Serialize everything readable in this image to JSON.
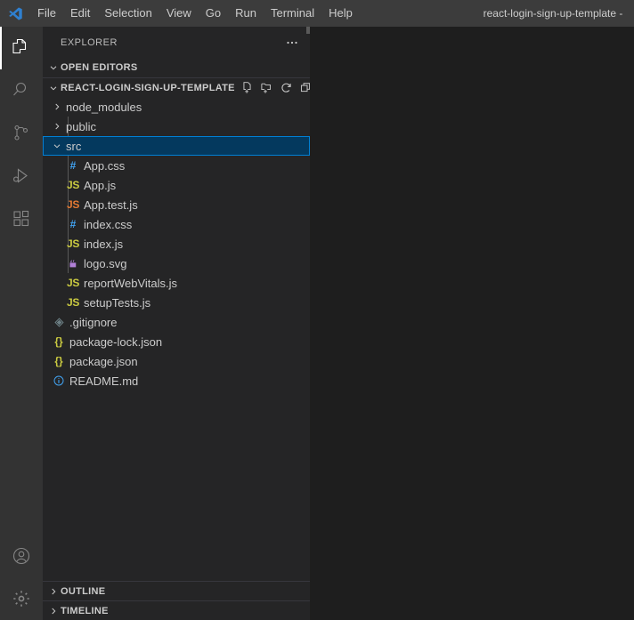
{
  "titlebar": {
    "logo_icon": "vscode-logo-icon",
    "window_title": "react-login-sign-up-template -",
    "menus": [
      {
        "label": "File"
      },
      {
        "label": "Edit"
      },
      {
        "label": "Selection"
      },
      {
        "label": "View"
      },
      {
        "label": "Go"
      },
      {
        "label": "Run"
      },
      {
        "label": "Terminal"
      },
      {
        "label": "Help"
      }
    ]
  },
  "activitybar": {
    "top_items": [
      {
        "name": "explorer",
        "icon": "files-icon",
        "title": "Explorer",
        "active": true
      },
      {
        "name": "search",
        "icon": "search-icon",
        "title": "Search",
        "active": false
      },
      {
        "name": "source-control",
        "icon": "source-control-icon",
        "title": "Source Control",
        "active": false
      },
      {
        "name": "run-debug",
        "icon": "run-and-debug-icon",
        "title": "Run and Debug",
        "active": false
      },
      {
        "name": "extensions",
        "icon": "extensions-icon",
        "title": "Extensions",
        "active": false
      }
    ],
    "bottom_items": [
      {
        "name": "accounts",
        "icon": "account-icon",
        "title": "Accounts"
      },
      {
        "name": "settings",
        "icon": "gear-icon",
        "title": "Manage"
      }
    ]
  },
  "sidebar": {
    "title": "EXPLORER",
    "more_actions_icon": "ellipsis-icon",
    "open_editors": {
      "label": "OPEN EDITORS",
      "expanded": true,
      "twisty_icon": "chevron-down-icon"
    },
    "workspace": {
      "label": "REACT-LOGIN-SIGN-UP-TEMPLATE",
      "expanded": true,
      "twisty_icon": "chevron-down-icon",
      "actions": [
        {
          "name": "new-file",
          "icon": "new-file-icon",
          "title": "New File"
        },
        {
          "name": "new-folder",
          "icon": "new-folder-icon",
          "title": "New Folder"
        },
        {
          "name": "refresh",
          "icon": "refresh-icon",
          "title": "Refresh Explorer"
        },
        {
          "name": "collapse-all",
          "icon": "collapse-all-icon",
          "title": "Collapse Folders in Explorer"
        }
      ]
    },
    "tree": [
      {
        "label": "node_modules",
        "type": "folder",
        "expanded": false,
        "depth": 0,
        "icon": "chevron-right-icon",
        "selected": false
      },
      {
        "label": "public",
        "type": "folder",
        "expanded": false,
        "depth": 0,
        "icon": "chevron-right-icon",
        "selected": false
      },
      {
        "label": "src",
        "type": "folder",
        "expanded": true,
        "depth": 0,
        "icon": "chevron-down-icon",
        "selected": true
      },
      {
        "label": "App.css",
        "type": "css",
        "depth": 1,
        "icon": "css-file-icon",
        "glyph": "#",
        "selected": false
      },
      {
        "label": "App.js",
        "type": "js",
        "depth": 1,
        "icon": "js-file-icon",
        "glyph": "JS",
        "selected": false
      },
      {
        "label": "App.test.js",
        "type": "jstest",
        "depth": 1,
        "icon": "js-test-file-icon",
        "glyph": "JS",
        "selected": false
      },
      {
        "label": "index.css",
        "type": "css",
        "depth": 1,
        "icon": "css-file-icon",
        "glyph": "#",
        "selected": false
      },
      {
        "label": "index.js",
        "type": "js",
        "depth": 1,
        "icon": "js-file-icon",
        "glyph": "JS",
        "selected": false
      },
      {
        "label": "logo.svg",
        "type": "svg",
        "depth": 1,
        "icon": "svg-file-icon",
        "selected": false
      },
      {
        "label": "reportWebVitals.js",
        "type": "js",
        "depth": 1,
        "icon": "js-file-icon",
        "glyph": "JS",
        "selected": false
      },
      {
        "label": "setupTests.js",
        "type": "js",
        "depth": 1,
        "icon": "js-file-icon",
        "glyph": "JS",
        "selected": false
      },
      {
        "label": ".gitignore",
        "type": "git",
        "depth": 0,
        "icon": "git-file-icon",
        "selected": false
      },
      {
        "label": "package-lock.json",
        "type": "json",
        "depth": 0,
        "icon": "json-file-icon",
        "glyph": "{}",
        "selected": false
      },
      {
        "label": "package.json",
        "type": "json",
        "depth": 0,
        "icon": "json-file-icon",
        "glyph": "{}",
        "selected": false
      },
      {
        "label": "README.md",
        "type": "md",
        "depth": 0,
        "icon": "markdown-file-icon",
        "selected": false
      }
    ],
    "bottom_panes": [
      {
        "label": "OUTLINE",
        "expanded": false,
        "twisty_icon": "chevron-right-icon"
      },
      {
        "label": "TIMELINE",
        "expanded": false,
        "twisty_icon": "chevron-right-icon"
      }
    ]
  },
  "editor": {
    "empty": true
  },
  "colors": {
    "titlebar_bg": "#3c3c3c",
    "activitybar_bg": "#333333",
    "sidebar_bg": "#252526",
    "editor_bg": "#1e1e1e",
    "selection_bg": "#04395e",
    "selection_border": "#007fd4",
    "text": "#cccccc",
    "js_yellow": "#cbcb41",
    "test_orange": "#e37933",
    "css_blue": "#42a5f5",
    "svg_purple": "#b180d7",
    "git_grey": "#6d8086"
  }
}
